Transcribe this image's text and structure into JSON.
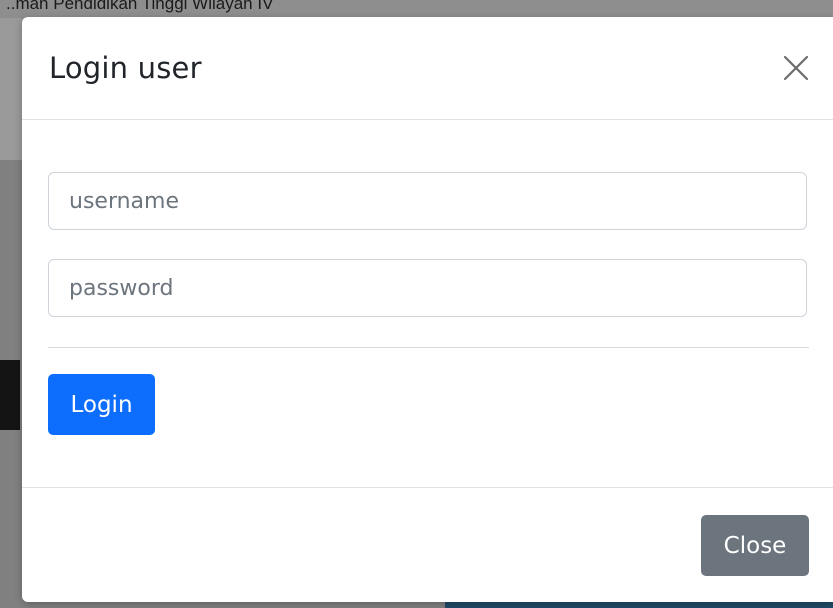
{
  "backdrop": {
    "header_text": "..man Pendidikan Tinggi Wilayah IV"
  },
  "modal": {
    "title": "Login user",
    "close_icon": "close-icon",
    "username": {
      "placeholder": "username",
      "value": ""
    },
    "password": {
      "placeholder": "password",
      "value": ""
    },
    "login_label": "Login",
    "close_label": "Close"
  },
  "colors": {
    "primary": "#0d6efd",
    "secondary": "#6c757d",
    "border": "#ced4da"
  }
}
